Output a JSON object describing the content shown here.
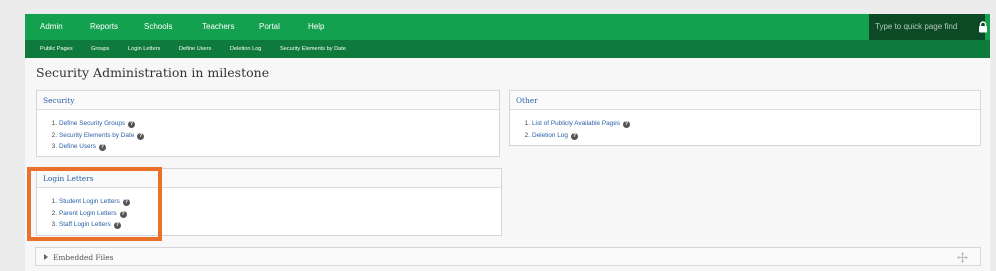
{
  "topnav": {
    "items": [
      "Admin",
      "Reports",
      "Schools",
      "Teachers",
      "Portal",
      "Help"
    ],
    "search_placeholder": "Type to quick page find"
  },
  "subnav": {
    "items": [
      "Public Pages",
      "Groups",
      "Login Letters",
      "Define Users",
      "Deletion Log",
      "Security Elements by Date"
    ]
  },
  "page": {
    "title": "Security Administration in milestone"
  },
  "panels": {
    "security": {
      "title": "Security",
      "items": [
        {
          "num": "1.",
          "label": "Define Security Groups"
        },
        {
          "num": "2.",
          "label": "Security Elements by Date"
        },
        {
          "num": "3.",
          "label": "Define Users"
        }
      ]
    },
    "other": {
      "title": "Other",
      "items": [
        {
          "num": "1.",
          "label": "List of Publicly Available Pages"
        },
        {
          "num": "2.",
          "label": "Deletion Log"
        }
      ]
    },
    "login_letters": {
      "title": "Login Letters",
      "items": [
        {
          "num": "1.",
          "label": "Student Login Letters"
        },
        {
          "num": "2.",
          "label": "Parent Login Letters"
        },
        {
          "num": "3.",
          "label": "Staff Login Letters"
        }
      ]
    }
  },
  "embedded": {
    "label": "Embedded Files"
  },
  "help_glyph": "?",
  "colors": {
    "nav_green": "#14a14f",
    "subnav_green": "#0e7a3b",
    "link_blue": "#2a62a8",
    "highlight_orange": "#e8712e"
  }
}
